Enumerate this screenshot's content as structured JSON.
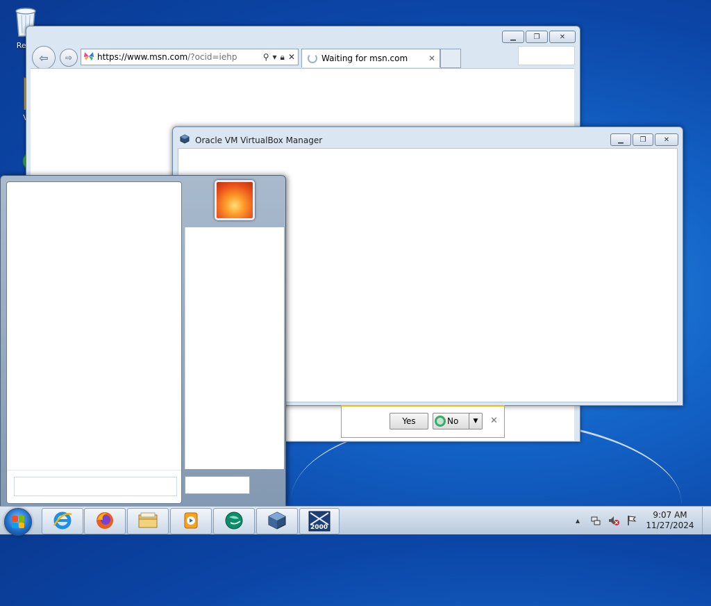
{
  "desktop": {
    "icons": [
      {
        "name": "recycle-bin",
        "label": "Recy"
      },
      {
        "name": "folder",
        "label": "V"
      },
      {
        "name": "globe",
        "label": ""
      }
    ]
  },
  "ie": {
    "address": "https://www.msn.com/?ocid=iehp",
    "address_host": "https://www.msn.com",
    "address_path": "/?ocid=iehp",
    "tab_title": "Waiting for msn.com"
  },
  "vbox": {
    "title": "Oracle VM VirtualBox Manager"
  },
  "notification": {
    "yes_label": "Yes",
    "no_label": "No"
  },
  "taskbar": {
    "apps": [
      {
        "name": "internet-explorer"
      },
      {
        "name": "firefox"
      },
      {
        "name": "windows-explorer"
      },
      {
        "name": "media-player"
      },
      {
        "name": "network-app"
      },
      {
        "name": "virtualbox"
      },
      {
        "name": "windows-2000-vm",
        "label": "2000"
      }
    ],
    "time": "9:07 AM",
    "date": "11/27/2024"
  },
  "colors": {
    "desktop": "#1464c8",
    "window_frame": "#dbe6f3",
    "notification_accent": "#e8c000"
  }
}
